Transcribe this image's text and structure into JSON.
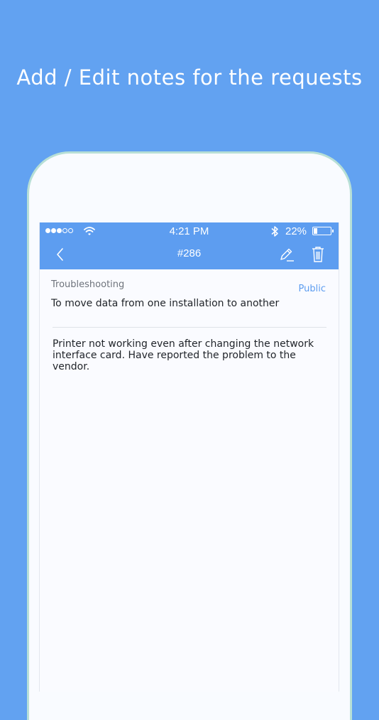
{
  "headline": "Add / Edit notes for the requests",
  "status_bar": {
    "time": "4:21 PM",
    "battery_pct": "22%",
    "battery_level": 0.22,
    "signal_dots": [
      true,
      true,
      true,
      false,
      false
    ],
    "icons": [
      "signal-dots-icon",
      "wifi-icon",
      "bluetooth-icon",
      "battery-icon"
    ]
  },
  "navbar": {
    "title": "#286",
    "icons": [
      "back-chevron-icon",
      "edit-pencil-icon",
      "trash-icon"
    ]
  },
  "note": {
    "category": "Troubleshooting",
    "visibility": "Public",
    "subject": "To move data from one installation to another",
    "body": "Printer not working even after changing the network interface card. Have reported the problem to the vendor."
  },
  "colors": {
    "background": "#62a2f1",
    "bar": "#5d9df0",
    "accent": "#5d9df0",
    "phone_frame": "#b7dfd6"
  }
}
